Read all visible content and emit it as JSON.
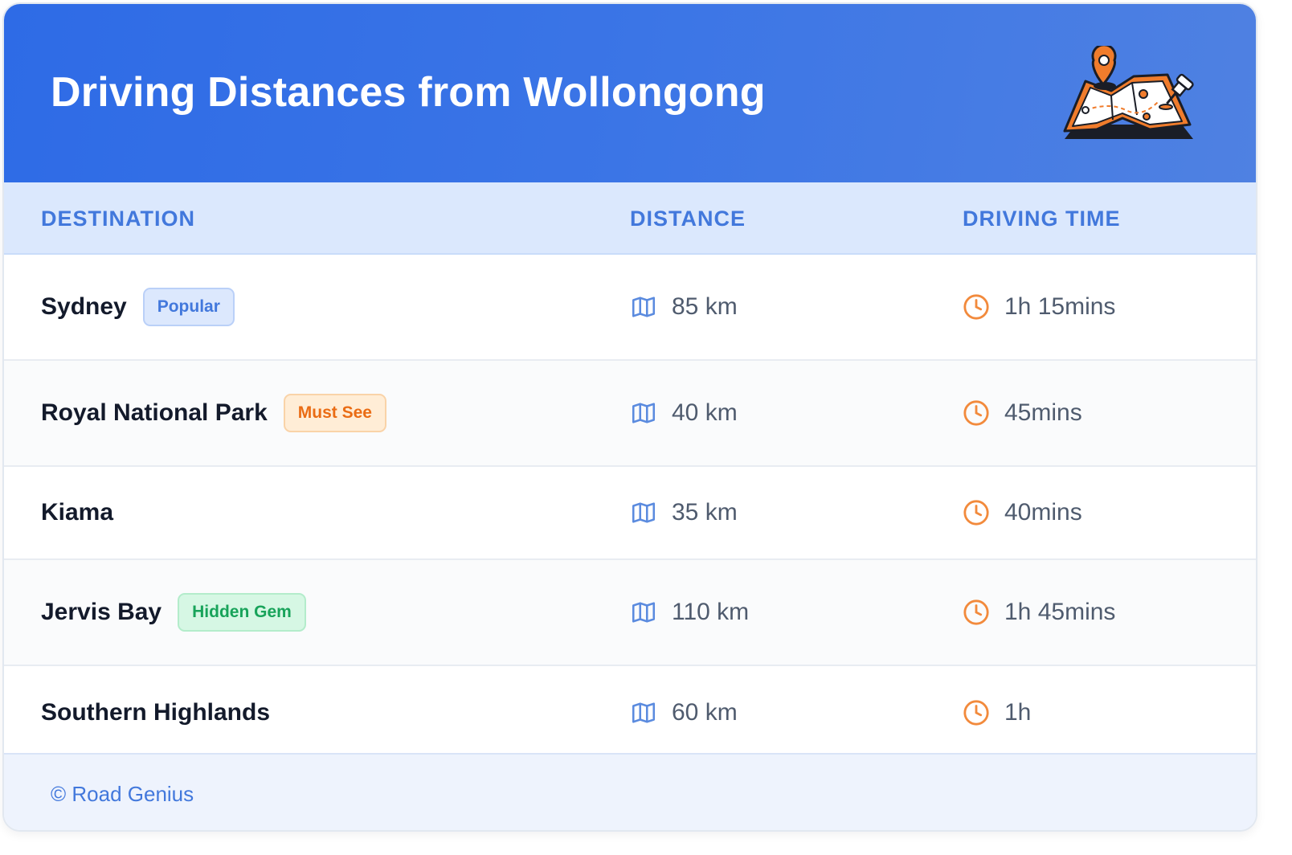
{
  "header": {
    "title": "Driving Distances from Wollongong",
    "logo_icon": "map-with-location-pin-icon"
  },
  "columns": {
    "destination": "DESTINATION",
    "distance": "DISTANCE",
    "driving_time": "DRIVING TIME"
  },
  "rows": [
    {
      "destination": "Sydney",
      "badge": "Popular",
      "badge_type": "popular",
      "distance": "85 km",
      "time": "1h 15mins"
    },
    {
      "destination": "Royal National Park",
      "badge": "Must See",
      "badge_type": "mustsee",
      "distance": "40 km",
      "time": "45mins"
    },
    {
      "destination": "Kiama",
      "badge": "",
      "badge_type": "",
      "distance": "35 km",
      "time": "40mins"
    },
    {
      "destination": "Jervis Bay",
      "badge": "Hidden Gem",
      "badge_type": "hidden",
      "distance": "110 km",
      "time": "1h 45mins"
    },
    {
      "destination": "Southern Highlands",
      "badge": "",
      "badge_type": "",
      "distance": "60 km",
      "time": "1h"
    }
  ],
  "icons": {
    "distance": "map-icon",
    "time": "clock-icon"
  },
  "footer": {
    "credit": "© Road Genius"
  },
  "colors": {
    "header_gradient_start": "#2e6be6",
    "header_gradient_end": "#4f81e2",
    "accent_blue": "#4278dc",
    "accent_orange": "#f07c2c",
    "badge_popular": "#dce8fd",
    "badge_mustsee": "#ffedd6",
    "badge_hidden": "#d6f7e4"
  }
}
